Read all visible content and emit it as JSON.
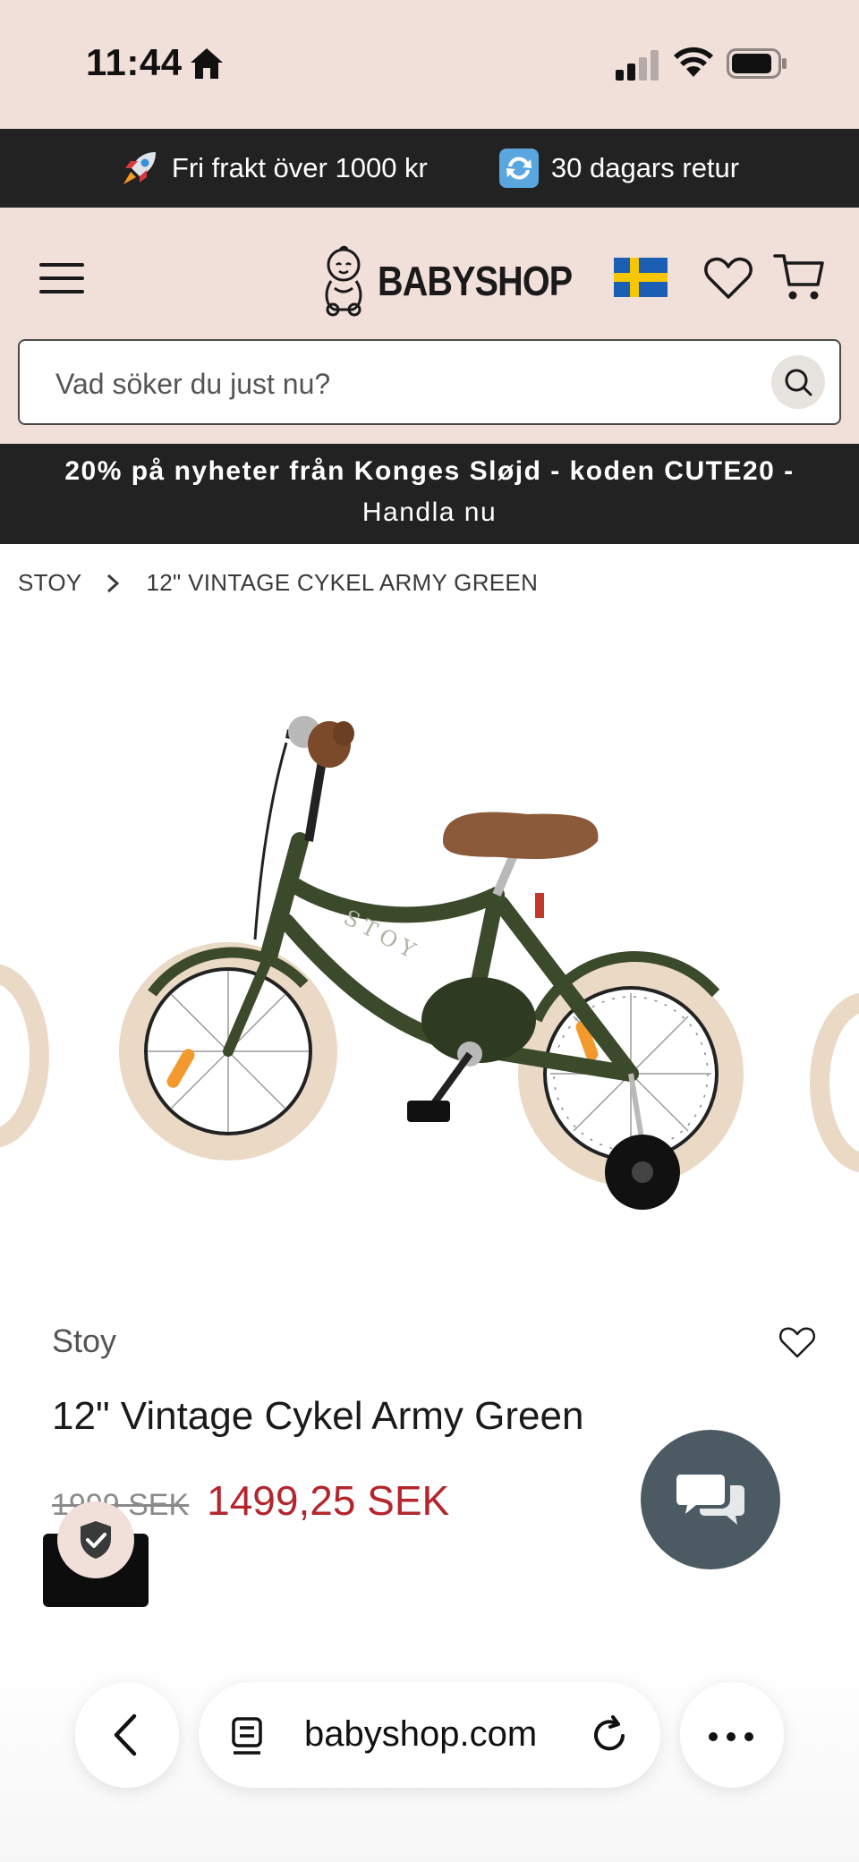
{
  "status_bar": {
    "time": "11:44"
  },
  "promo_bar": {
    "items": [
      {
        "icon": "rocket-icon",
        "text": "Fri frakt över 1000 kr"
      },
      {
        "icon": "return-arrows-icon",
        "text": "30 dagars retur"
      }
    ]
  },
  "header": {
    "logo_text": "BABYSHOP",
    "country_flag": "sweden-flag-icon",
    "search": {
      "placeholder": "Vad söker du just nu?"
    }
  },
  "campaign": {
    "line1": "20% på nyheter från Konges Sløjd - koden CUTE20 -",
    "line2": "Handla nu"
  },
  "breadcrumb": {
    "items": [
      "STOY",
      "12\" VINTAGE CYKEL ARMY GREEN"
    ]
  },
  "product": {
    "brand": "Stoy",
    "title": "12\" Vintage Cykel Army Green",
    "old_price": "1999 SEK",
    "price": "1499,25 SEK",
    "colors": {
      "price_sale": "#b3262e",
      "bike_frame": "#3c4a2c",
      "tire": "#ead9c4",
      "saddle": "#8a5a3a"
    }
  },
  "browser": {
    "url": "babyshop.com"
  },
  "colors": {
    "header_bg": "#f1dfda",
    "dark_bar": "#222222",
    "chat_button": "#4c5b63"
  }
}
